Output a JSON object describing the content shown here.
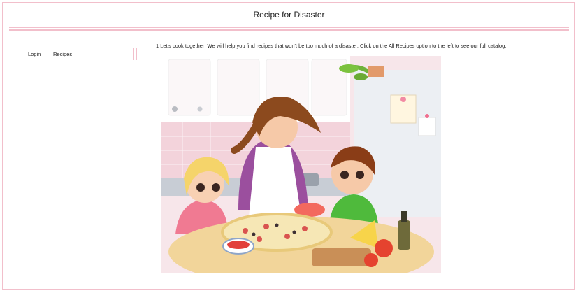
{
  "header": {
    "title": "Recipe for Disaster"
  },
  "nav": {
    "login": "Login",
    "recipes": "Recipes"
  },
  "main": {
    "intro": "1 Let's cook together! We will help you find recipes that won't be too much of a disaster. Click on the All Recipes option to the left to see our full catalog.",
    "image_alt": "Family cooking pizza together illustration"
  },
  "colors": {
    "accent_border": "#f2bfcb",
    "background": "#ffffff",
    "text": "#222222"
  }
}
